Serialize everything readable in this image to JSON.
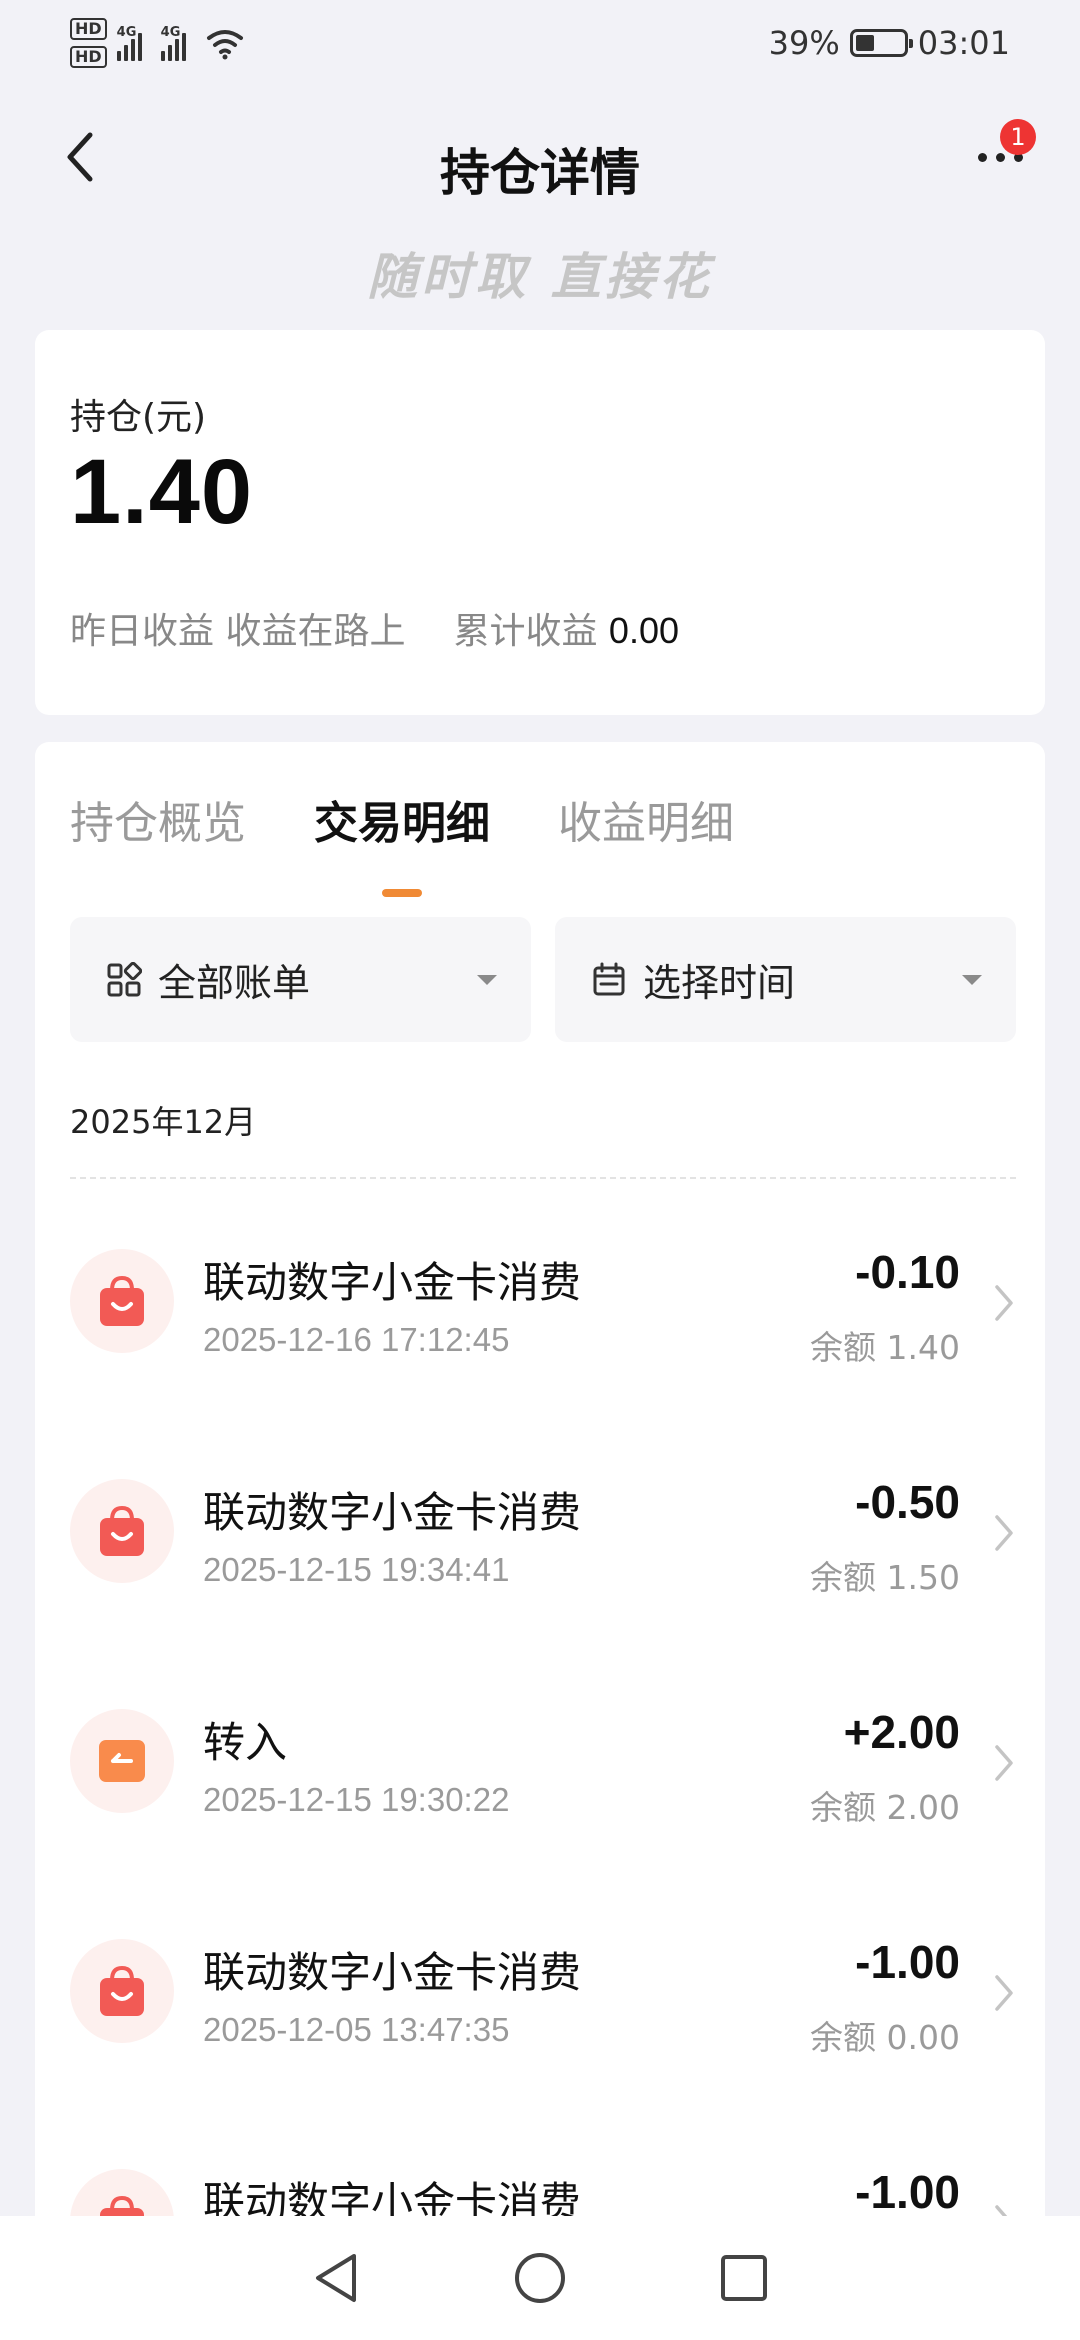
{
  "status_bar": {
    "network_1": "4G",
    "network_2": "4G",
    "battery_text": "39%",
    "battery_level": 0.39,
    "time": "03:01"
  },
  "header": {
    "title": "持仓详情",
    "notification_count": "1",
    "slogan": "随时取 直接花"
  },
  "summary": {
    "holding_label": "持仓(元)",
    "holding_value": "1.40",
    "yesterday_label": "昨日收益 收益在路上",
    "cumulative_label": "累计收益",
    "cumulative_value": "0.00"
  },
  "tabs": [
    {
      "label": "持仓概览",
      "active": false
    },
    {
      "label": "交易明细",
      "active": true
    },
    {
      "label": "收益明细",
      "active": false
    }
  ],
  "filters": {
    "bill_type": "全部账单",
    "time": "选择时间"
  },
  "month_label": "2025年12月",
  "transactions": [
    {
      "title": "联动数字小金卡消费",
      "time": "2025-12-16 17:12:45",
      "amount": "-0.10",
      "balance": "余额 1.40",
      "icon": "shopping-bag-icon"
    },
    {
      "title": "联动数字小金卡消费",
      "time": "2025-12-15 19:34:41",
      "amount": "-0.50",
      "balance": "余额 1.50",
      "icon": "shopping-bag-icon"
    },
    {
      "title": "转入",
      "time": "2025-12-15 19:30:22",
      "amount": "+2.00",
      "balance": "余额 2.00",
      "icon": "transfer-in-icon"
    },
    {
      "title": "联动数字小金卡消费",
      "time": "2025-12-05 13:47:35",
      "amount": "-1.00",
      "balance": "余额 0.00",
      "icon": "shopping-bag-icon"
    },
    {
      "title": "联动数字小金卡消费",
      "time": "",
      "amount": "-1.00",
      "balance": "",
      "icon": "shopping-bag-icon"
    }
  ],
  "colors": {
    "accent": "#f08a35",
    "badge": "#ee3433",
    "bag_icon": "#f25a55",
    "transfer_icon": "#f98b4c"
  }
}
